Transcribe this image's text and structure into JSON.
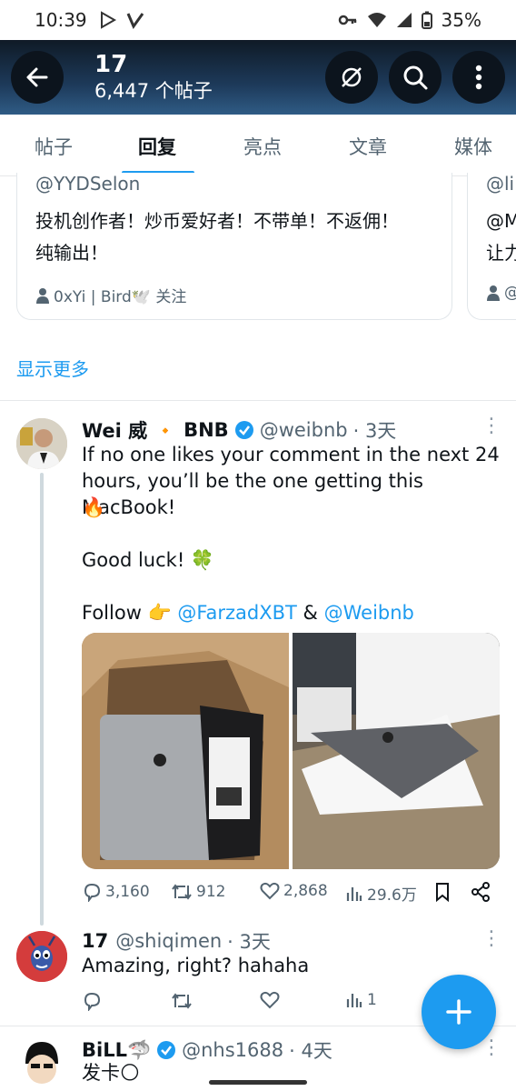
{
  "status_bar": {
    "time": "10:39",
    "battery": "35%"
  },
  "header": {
    "title": "17",
    "subtitle": "6,447 个帖子"
  },
  "tabs": [
    {
      "label": "帖子"
    },
    {
      "label": "回复"
    },
    {
      "label": "亮点"
    },
    {
      "label": "文章"
    },
    {
      "label": "媒体"
    }
  ],
  "cards": [
    {
      "handle": "@YYDSelon",
      "bio_line1": "投机创作者！炒币爱好者！不带单！不返佣！",
      "bio_line2": "纯输出！",
      "followed_by": "0xYi | Bird🕊️ 关注"
    },
    {
      "handle": "@li",
      "bio_line1": "@M",
      "bio_line2": "让力",
      "followed_by": "@"
    }
  ],
  "show_more": "显示更多",
  "posts": [
    {
      "name": "Wei 威",
      "badge": "🔸",
      "name2": "BNB",
      "handle": "@weibnb",
      "time": "· 3天",
      "text_line1": "If no one likes your comment in the next 24",
      "text_line2": "hours, you’ll be the one getting this MacBook!",
      "emoji_fire": "🔥",
      "good_luck": "Good luck! 🍀",
      "follow_prefix": "Follow 👉 ",
      "mention1": "@FarzadXBT",
      "amp": " & ",
      "mention2": "@Weibnb",
      "stats": {
        "replies": "3,160",
        "reposts": "912",
        "likes": "2,868",
        "views": "29.6万"
      }
    },
    {
      "name": "17",
      "handle": "@shiqimen",
      "time": "· 3天",
      "text": "Amazing, right? hahaha",
      "stats": {
        "views": "1"
      }
    },
    {
      "name": "BiLL🦈",
      "handle": "@nhs1688",
      "time": "· 4天",
      "text": "发卡🌕"
    }
  ],
  "colors": {
    "accent": "#1d9bf0",
    "header_bg": "#1d3a5a",
    "muted": "#536471"
  }
}
